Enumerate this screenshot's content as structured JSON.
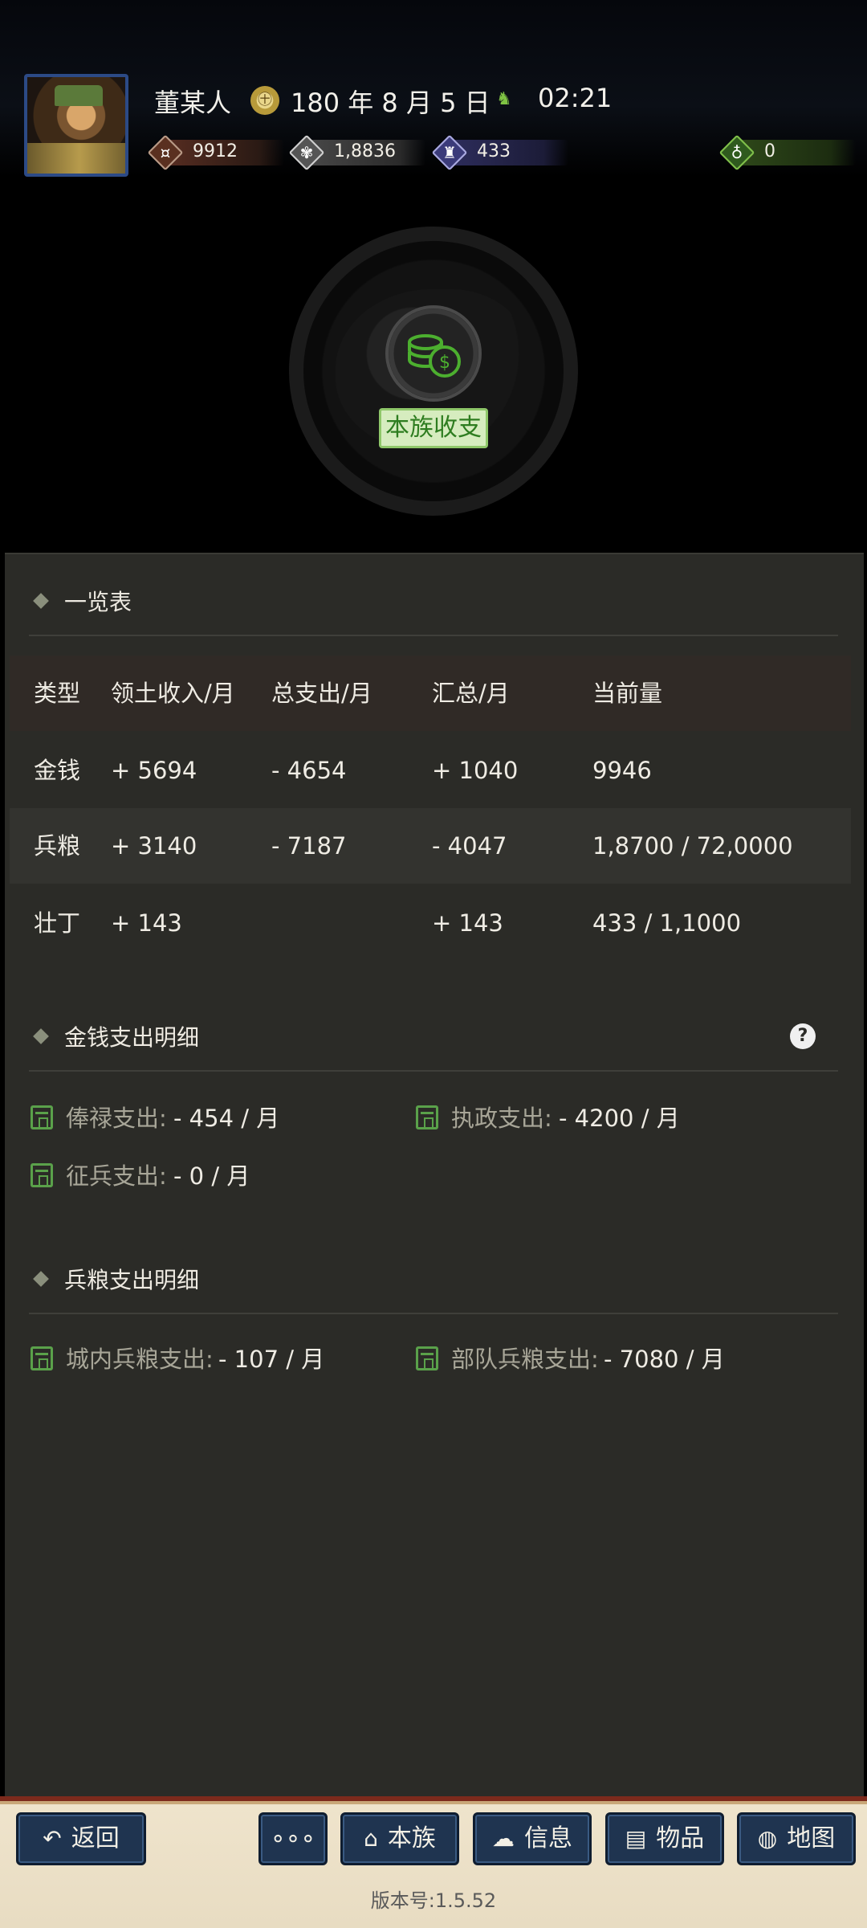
{
  "header": {
    "username": "董某人",
    "date": "180 年 8 月 5 日",
    "time": "02:21",
    "date_icon": "seal-icon",
    "time_icon": "horse-icon"
  },
  "resources": [
    {
      "icon": "money-icon",
      "value": "9912",
      "color": "#6a3a2a"
    },
    {
      "icon": "grain-icon",
      "value": "1,8836",
      "color": "#4a4a4a"
    },
    {
      "icon": "strength-icon",
      "value": "433",
      "color": "#2e2e5e"
    },
    {
      "icon": "bag-icon",
      "value": "0",
      "color": "#2f4a1a"
    }
  ],
  "emblem": {
    "label": "本族收支"
  },
  "overview": {
    "title": "一览表",
    "columns": [
      "类型",
      "领土收入/月",
      "总支出/月",
      "汇总/月",
      "当前量"
    ],
    "rows": [
      [
        "金钱",
        "+ 5694",
        "- 4654",
        "+ 1040",
        "9946"
      ],
      [
        "兵粮",
        "+ 3140",
        "- 7187",
        "- 4047",
        "1,8700 / 72,0000"
      ],
      [
        "壮丁",
        "+ 143",
        "",
        "+ 143",
        "433 / 1,1000"
      ]
    ]
  },
  "money_detail": {
    "title": "金钱支出明细",
    "help": "?",
    "items": [
      {
        "label": "俸禄支出:",
        "amount": "- 454 / 月"
      },
      {
        "label": "执政支出:",
        "amount": "- 4200 / 月"
      },
      {
        "label": "征兵支出:",
        "amount": "- 0 / 月"
      }
    ]
  },
  "grain_detail": {
    "title": "兵粮支出明细",
    "items": [
      {
        "label": "城内兵粮支出:",
        "amount": "- 107 / 月"
      },
      {
        "label": "部队兵粮支出:",
        "amount": "- 7080 / 月"
      }
    ]
  },
  "nav": {
    "back": "返回",
    "more": "∘∘∘",
    "clan": "本族",
    "info": "信息",
    "items": "物品",
    "map": "地图",
    "icons": {
      "back": "back-arrow-icon",
      "clan": "home-icon",
      "info": "chat-icon",
      "items": "box-icon",
      "map": "globe-icon"
    }
  },
  "version": "版本号:1.5.52",
  "colors": {
    "panel": "#2b2b27",
    "accent_green": "#5aa14a",
    "nav_button": "#1f3450",
    "bottom_bar": "#efe4cc"
  }
}
